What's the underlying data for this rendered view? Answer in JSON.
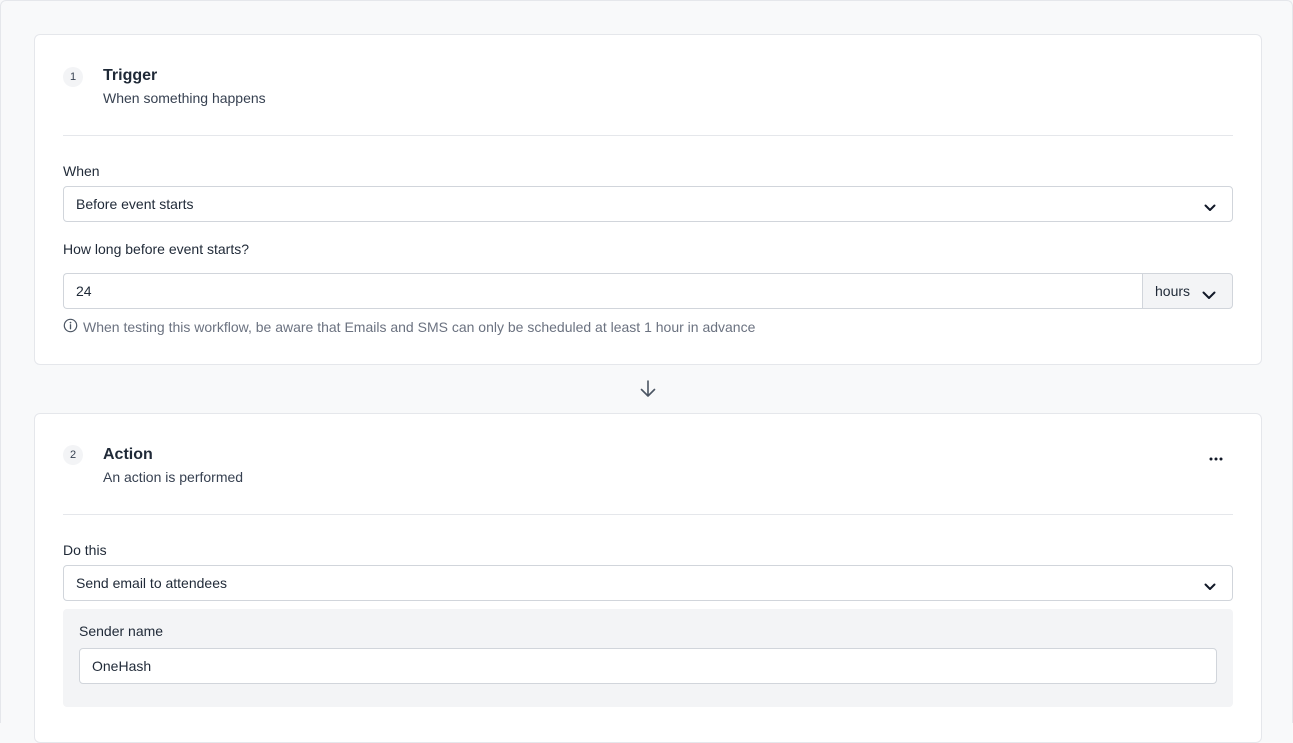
{
  "trigger": {
    "step_number": "1",
    "title": "Trigger",
    "subtitle": "When something happens",
    "when_label": "When",
    "when_value": "Before event starts",
    "duration_label": "How long before event starts?",
    "duration_value": "24",
    "duration_unit": "hours",
    "hint": "When testing this workflow, be aware that Emails and SMS can only be scheduled at least 1 hour in advance"
  },
  "action": {
    "step_number": "2",
    "title": "Action",
    "subtitle": "An action is performed",
    "do_this_label": "Do this",
    "do_this_value": "Send email to attendees",
    "sender_name_label": "Sender name",
    "sender_name_value": "OneHash"
  },
  "icons": {
    "chevron": "chevron-down-icon",
    "info": "info-icon",
    "arrow": "arrow-down-icon",
    "more": "more-horizontal-icon"
  }
}
